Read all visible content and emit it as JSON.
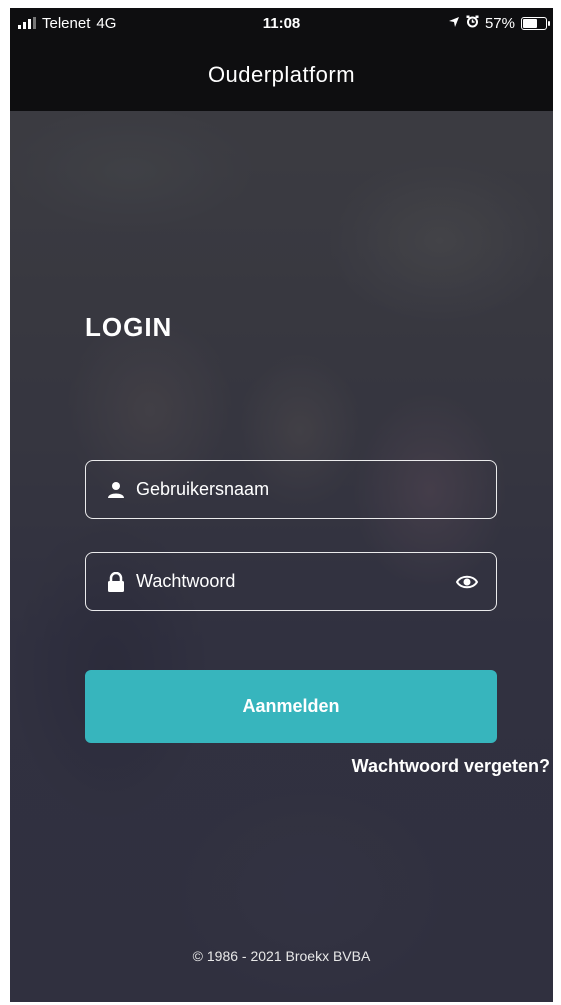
{
  "status_bar": {
    "carrier": "Telenet",
    "network": "4G",
    "time": "11:08",
    "battery": "57%",
    "battery_level": 0.57,
    "icons": [
      "signal-icon",
      "location-arrow-icon",
      "alarm-icon",
      "battery-icon"
    ]
  },
  "nav": {
    "title": "Ouderplatform"
  },
  "login": {
    "heading": "LOGIN",
    "username_placeholder": "Gebruikersnaam",
    "username_value": "",
    "password_placeholder": "Wachtwoord",
    "password_value": "",
    "submit_label": "Aanmelden",
    "forgot_label": "Wachtwoord vergeten?"
  },
  "footer": {
    "copyright": "© 1986 - 2021 Broekx BVBA"
  },
  "colors": {
    "accent": "#37b5bd",
    "bar_background": "#0e0e10",
    "overlay": "#262637"
  }
}
